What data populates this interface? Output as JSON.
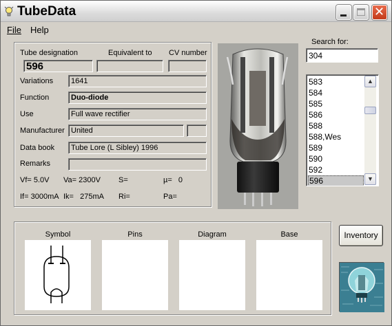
{
  "window": {
    "title": "TubeData"
  },
  "menu": {
    "file": "File",
    "help": "Help"
  },
  "headers": {
    "tube_designation": "Tube designation",
    "equivalent_to": "Equivalent to",
    "cv_number": "CV number"
  },
  "fields": {
    "designation": "596",
    "equivalent": "",
    "cv": "",
    "variations": {
      "label": "Variations",
      "value": "1641"
    },
    "function": {
      "label": "Function",
      "value": "Duo-diode"
    },
    "use": {
      "label": "Use",
      "value": "Full wave rectifier"
    },
    "manufacturer": {
      "label": "Manufacturer",
      "value": "United",
      "extra": ""
    },
    "data_book": {
      "label": "Data book",
      "value": "Tube Lore (L Sibley) 1996"
    },
    "remarks": {
      "label": "Remarks",
      "value": ""
    }
  },
  "params": {
    "vf": "Vf= 5.0V",
    "va": "Va= 2300V",
    "s": "S=",
    "mu": "µ=   0",
    "if": "If= 3000mA",
    "ik": "Ik=   275mA",
    "ri": "Ri=",
    "pa": "Pa="
  },
  "search": {
    "label": "Search for:",
    "value": "304"
  },
  "list": {
    "items": [
      "583",
      "584",
      "585",
      "586",
      "588",
      "588,Wes",
      "589",
      "590",
      "592",
      "596"
    ],
    "selected": "596"
  },
  "panels": {
    "symbol": "Symbol",
    "pins": "Pins",
    "diagram": "Diagram",
    "base": "Base"
  },
  "buttons": {
    "inventory": "Inventory"
  }
}
